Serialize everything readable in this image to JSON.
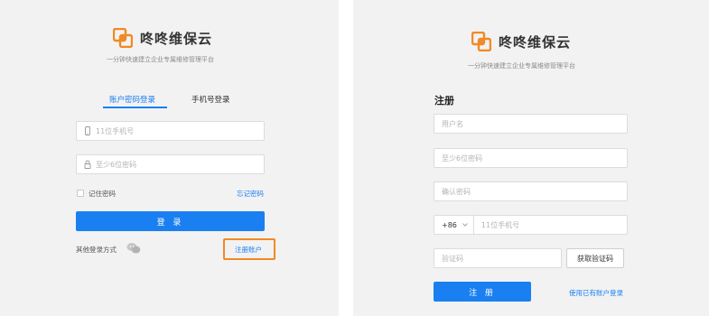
{
  "brand": {
    "name": "咚咚维保云",
    "slogan": "一分钟快速建立企业专属维修管理平台"
  },
  "login": {
    "tabs": [
      {
        "label": "账户密码登录",
        "active": true
      },
      {
        "label": "手机号登录",
        "active": false
      }
    ],
    "phone_placeholder": "11位手机号",
    "password_placeholder": "至少6位密码",
    "remember_label": "记住密码",
    "forgot_label": "忘记密码",
    "submit_label": "登 录",
    "other_methods_label": "其他登录方式",
    "register_link": "注册账户"
  },
  "register": {
    "title": "注册",
    "username_placeholder": "用户名",
    "password_placeholder": "至少6位密码",
    "confirm_placeholder": "确认密码",
    "country_code": "+86",
    "phone_placeholder": "11位手机号",
    "code_placeholder": "验证码",
    "get_code_label": "获取验证码",
    "submit_label": "注 册",
    "login_link": "使用已有账户登录"
  },
  "colors": {
    "accent": "#1a7ff0",
    "brand_orange": "#f08a24",
    "highlight": "#f08a24"
  }
}
